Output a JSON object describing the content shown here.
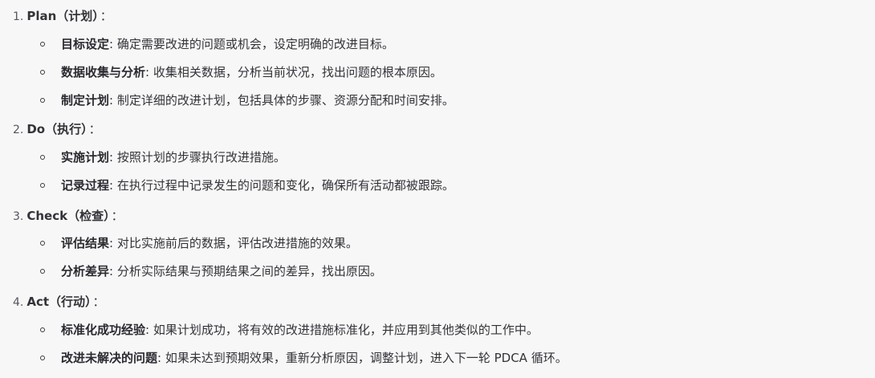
{
  "sections": [
    {
      "number": "1.",
      "heading": "Plan（计划）",
      "colon": "：",
      "items": [
        {
          "term": "目标设定",
          "sep": ":",
          "desc": " 确定需要改进的问题或机会，设定明确的改进目标。"
        },
        {
          "term": "数据收集与分析",
          "sep": ":",
          "desc": " 收集相关数据，分析当前状况，找出问题的根本原因。"
        },
        {
          "term": "制定计划",
          "sep": ":",
          "desc": " 制定详细的改进计划，包括具体的步骤、资源分配和时间安排。"
        }
      ]
    },
    {
      "number": "2.",
      "heading": "Do（执行）",
      "colon": "：",
      "items": [
        {
          "term": "实施计划",
          "sep": ":",
          "desc": " 按照计划的步骤执行改进措施。"
        },
        {
          "term": "记录过程",
          "sep": ":",
          "desc": " 在执行过程中记录发生的问题和变化，确保所有活动都被跟踪。"
        }
      ]
    },
    {
      "number": "3.",
      "heading": "Check（检查）",
      "colon": "：",
      "items": [
        {
          "term": "评估结果",
          "sep": ":",
          "desc": " 对比实施前后的数据，评估改进措施的效果。"
        },
        {
          "term": "分析差异",
          "sep": ":",
          "desc": " 分析实际结果与预期结果之间的差异，找出原因。"
        }
      ]
    },
    {
      "number": "4.",
      "heading": "Act（行动）",
      "colon": "：",
      "items": [
        {
          "term": "标准化成功经验",
          "sep": ":",
          "desc": " 如果计划成功，将有效的改进措施标准化，并应用到其他类似的工作中。"
        },
        {
          "term": "改进未解决的问题",
          "sep": ":",
          "desc": " 如果未达到预期效果，重新分析原因，调整计划，进入下一轮 PDCA 循环。"
        }
      ]
    }
  ]
}
